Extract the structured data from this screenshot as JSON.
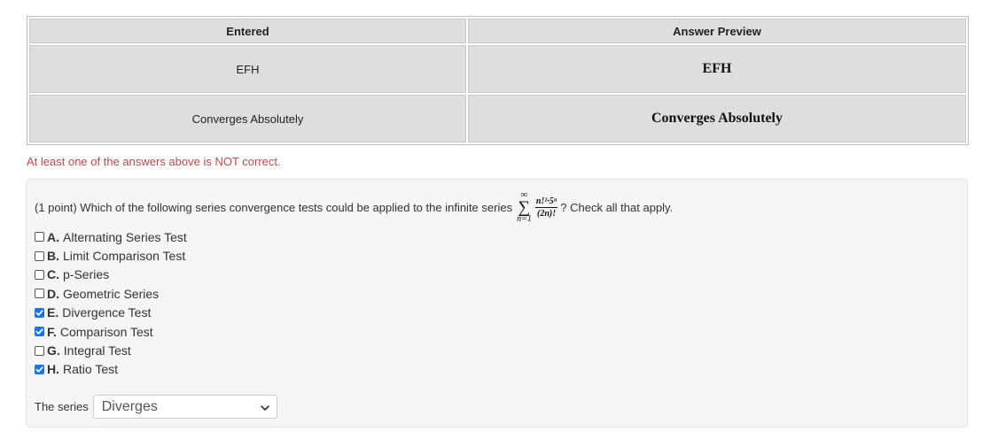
{
  "results": {
    "headers": [
      "Entered",
      "Answer Preview"
    ],
    "rows": [
      {
        "entered": "EFH",
        "preview": "EFH"
      },
      {
        "entered": "Converges Absolutely",
        "preview": "Converges Absolutely"
      }
    ]
  },
  "feedback": "At least one of the answers above is NOT correct.",
  "problem": {
    "question_before": "(1 point) Which of the following series convergence tests could be applied to the infinite series",
    "question_after": "? Check all that apply.",
    "math": {
      "sum_upper": "∞",
      "sum_symbol": "∑",
      "sum_lower": "n=1",
      "numerator": "n!²·5ⁿ",
      "denominator": "(2n)!"
    },
    "options": [
      {
        "letter": "A.",
        "label": "Alternating Series Test",
        "checked": false
      },
      {
        "letter": "B.",
        "label": "Limit Comparison Test",
        "checked": false
      },
      {
        "letter": "C.",
        "label": "p-Series",
        "checked": false
      },
      {
        "letter": "D.",
        "label": "Geometric Series",
        "checked": false
      },
      {
        "letter": "E.",
        "label": "Divergence Test",
        "checked": true
      },
      {
        "letter": "F.",
        "label": "Comparison Test",
        "checked": true
      },
      {
        "letter": "G.",
        "label": "Integral Test",
        "checked": false
      },
      {
        "letter": "H.",
        "label": "Ratio Test",
        "checked": true
      }
    ],
    "series_label": "The series",
    "series_select": {
      "selected": "Diverges"
    }
  },
  "colors": {
    "error_text": "#b94a48",
    "checkbox_checked": "#1a73e8",
    "table_cell_bg": "#dedede",
    "problem_bg": "#f5f5f5"
  }
}
